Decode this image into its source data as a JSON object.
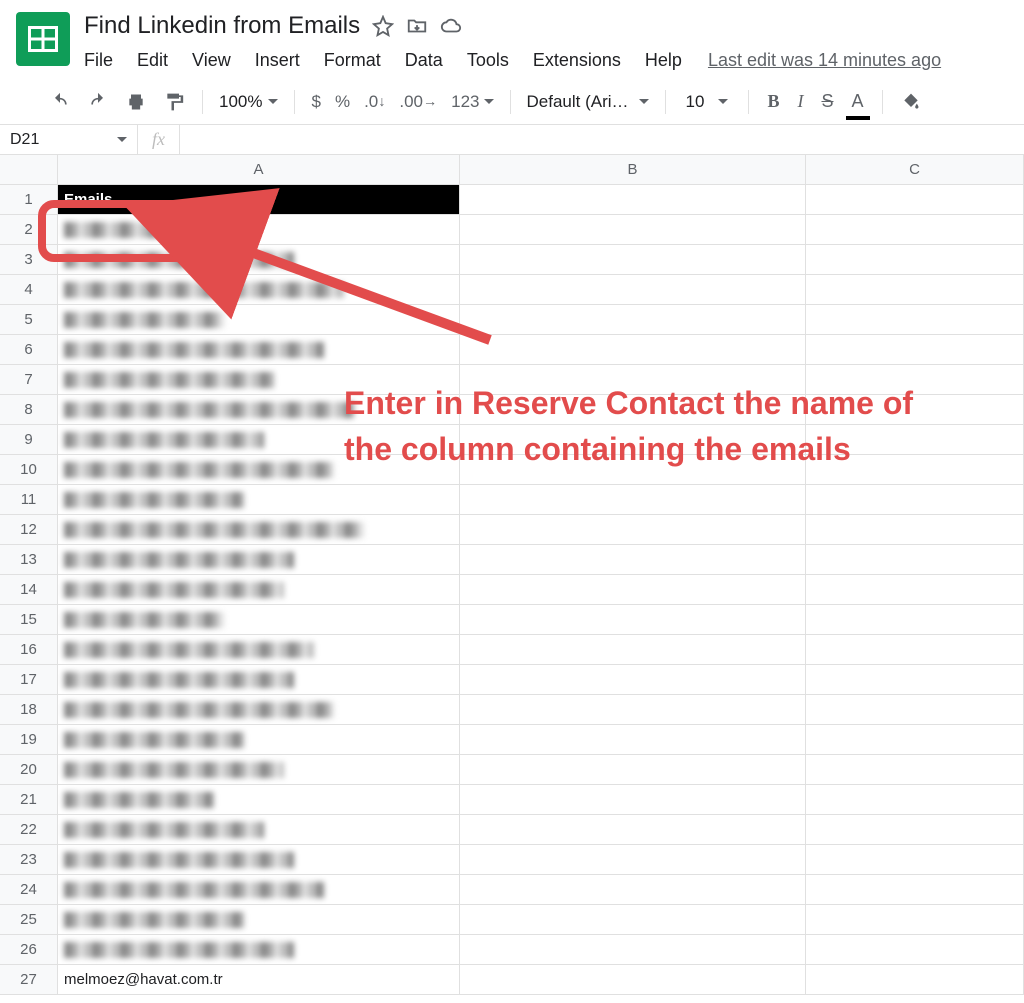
{
  "header": {
    "doc_title": "Find Linkedin from Emails"
  },
  "menubar": {
    "items": [
      "File",
      "Edit",
      "View",
      "Insert",
      "Format",
      "Data",
      "Tools",
      "Extensions",
      "Help"
    ],
    "last_edit": "Last edit was 14 minutes ago"
  },
  "toolbar": {
    "zoom": "100%",
    "currency": "$",
    "percent": "%",
    "dec_dec": ".0",
    "inc_dec": ".00",
    "num_fmt": "123",
    "font_name": "Default (Ari…",
    "font_size": "10",
    "bold": "B",
    "italic": "I",
    "strike": "S",
    "text_color": "A"
  },
  "namebox": {
    "ref": "D21",
    "fx": "fx"
  },
  "grid": {
    "col_headers": [
      "A",
      "B",
      "C"
    ],
    "row_count": 27,
    "a1": "Emails",
    "a27": "melmoez@havat.com.tr",
    "blur_widths": [
      0,
      150,
      230,
      280,
      160,
      260,
      210,
      290,
      200,
      270,
      180,
      300,
      230,
      220,
      160,
      250,
      230,
      270,
      180,
      220,
      150,
      200,
      230,
      260,
      180,
      230
    ]
  },
  "annotation": {
    "text": "Enter in Reserve Contact the name of the column containing the emails"
  }
}
